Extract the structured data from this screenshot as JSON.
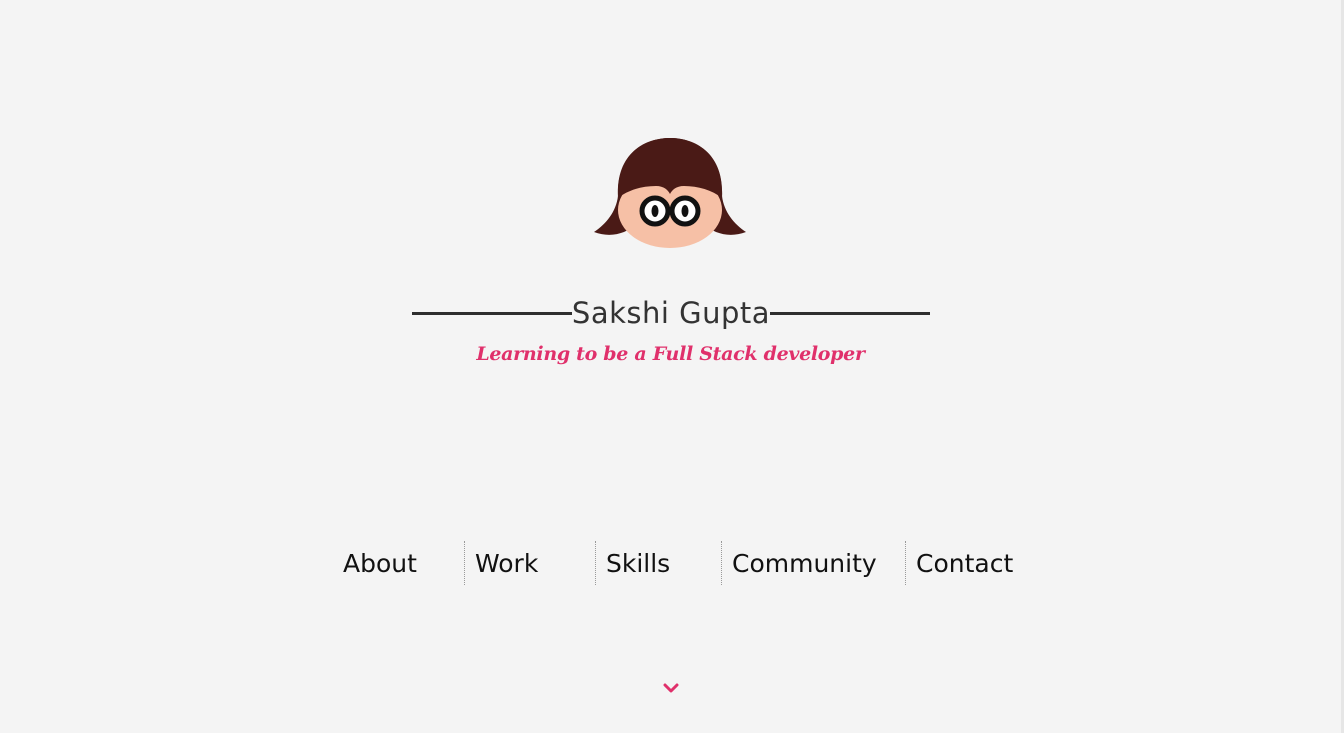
{
  "profile": {
    "name": "Sakshi Gupta",
    "tagline": "Learning to be a Full Stack developer",
    "avatar_icon": "girl-with-glasses-avatar-icon"
  },
  "nav": {
    "items": [
      {
        "label": "About"
      },
      {
        "label": "Work"
      },
      {
        "label": "Skills"
      },
      {
        "label": "Community"
      },
      {
        "label": "Contact"
      }
    ]
  },
  "scroll": {
    "icon": "chevron-down-icon"
  },
  "colors": {
    "background": "#f4f4f4",
    "accent": "#e0306b",
    "hair": "#4a1a16",
    "skin": "#f6c0a6",
    "text": "#333333"
  }
}
